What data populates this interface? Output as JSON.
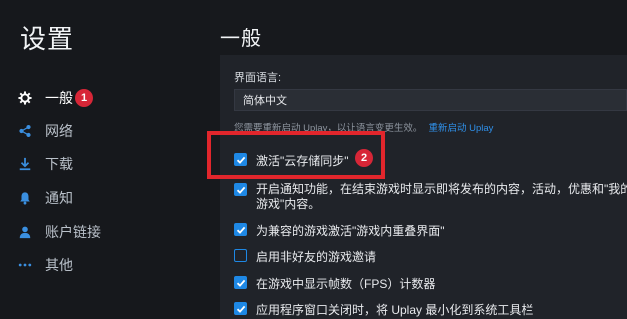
{
  "sidebar": {
    "title": "设置",
    "items": [
      {
        "label": "一般",
        "icon": "gear-icon"
      },
      {
        "label": "网络",
        "icon": "network-icon"
      },
      {
        "label": "下载",
        "icon": "download-icon"
      },
      {
        "label": "通知",
        "icon": "bell-icon"
      },
      {
        "label": "账户链接",
        "icon": "user-icon"
      },
      {
        "label": "其他",
        "icon": "more-icon"
      }
    ],
    "badge": "1"
  },
  "main": {
    "title": "一般",
    "language": {
      "label": "界面语言:",
      "value": "简体中文"
    },
    "restart_notice": "您需要重新启动 Uplay，以让语言变更生效。",
    "restart_link": "重新启动 Uplay",
    "badge": "2",
    "options": [
      {
        "label": "激活\"云存储同步\"",
        "checked": true
      },
      {
        "label": "开启通知功能，在结束游戏时显示即将发布的内容，活动，优惠和\"我的游戏\"内容。",
        "checked": true
      },
      {
        "label": "为兼容的游戏激活\"游戏内重叠界面\"",
        "checked": true
      },
      {
        "label": "启用非好友的游戏邀请",
        "checked": false
      },
      {
        "label": "在游戏中显示帧数（FPS）计数器",
        "checked": true
      },
      {
        "label": "应用程序窗口关闭时，将 Uplay 最小化到系统工具栏",
        "checked": true
      }
    ]
  },
  "colors": {
    "accent": "#1e88e5",
    "link": "#2f8fe8",
    "badge": "#d72637",
    "highlight": "#e2262c"
  }
}
